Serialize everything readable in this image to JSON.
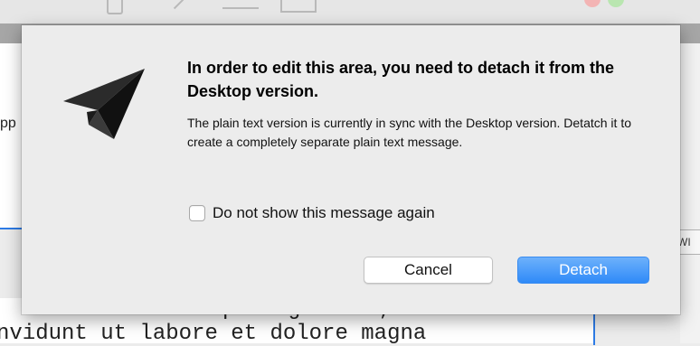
{
  "background": {
    "left_panel_text": "pp",
    "right_panel_label": "WI",
    "editor_lines": [
      "consetetur sadipscing elitr, sed",
      "nvidunt ut labore et dolore magna"
    ]
  },
  "dialog": {
    "icon": "paper-plane-icon",
    "title": "In order to edit this area, you need to detach it from the Desktop version.",
    "message": "The plain text version is currently in sync with the Desktop version. Detatch it to create a completely separate plain text message.",
    "checkbox": {
      "label": "Do not show this message again",
      "checked": false
    },
    "buttons": {
      "cancel": "Cancel",
      "detach": "Detach"
    }
  },
  "colors": {
    "accent": "#2f8af8",
    "sheet_background": "#ececec"
  }
}
